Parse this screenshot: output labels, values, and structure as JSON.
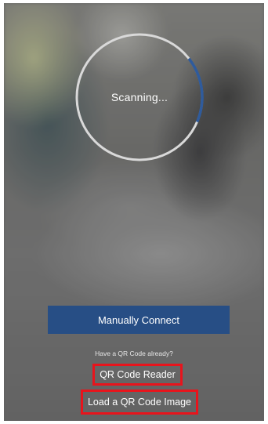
{
  "scanner": {
    "status_text": "Scanning...",
    "progress": 0.17,
    "ring_color": "#d9d9d9",
    "progress_color": "#2f5b9c"
  },
  "actions": {
    "manual_connect_label": "Manually Connect",
    "hint_text": "Have a QR Code already?",
    "qr_reader_label": "QR Code Reader",
    "load_qr_image_label": "Load a QR Code Image"
  },
  "colors": {
    "primary_button": "#274e85",
    "highlight_box": "#e8141c"
  }
}
